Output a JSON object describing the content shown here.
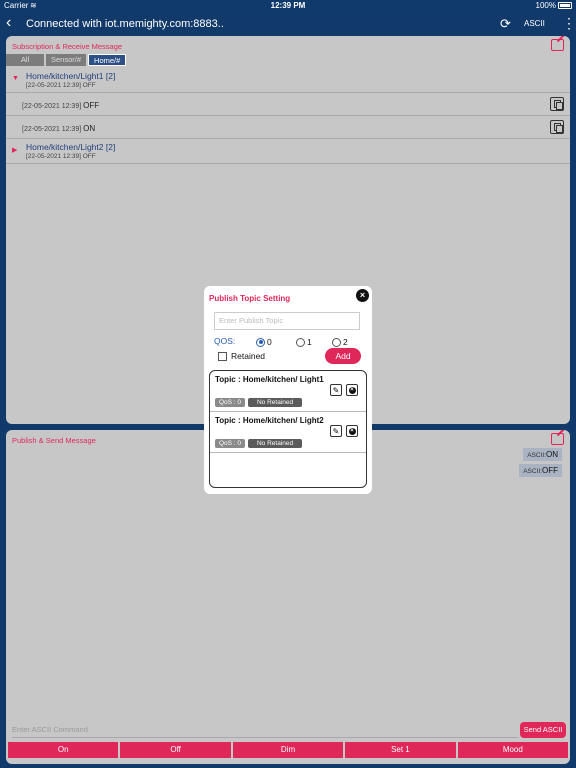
{
  "status_bar": {
    "carrier": "Carrier",
    "time": "12:39 PM",
    "battery": "100%"
  },
  "nav": {
    "title": "Connected with iot.memighty.com:8883..",
    "ascii_label": "ASCII"
  },
  "subscription": {
    "title": "Subscription & Receive Message",
    "filters": [
      "All",
      "Sensor/#",
      "Home/#"
    ],
    "groups": [
      {
        "topic": "Home/kitchen/Light1 [2]",
        "latest": "[22-05-2021 12:39] OFF"
      },
      {
        "topic": "Home/kitchen/Light2 [2]",
        "latest": "[22-05-2021 12:39] OFF"
      }
    ],
    "messages": [
      {
        "ts": "[22-05-2021 12:39]",
        "value": "OFF"
      },
      {
        "ts": "[22-05-2021 12:39]",
        "value": "ON"
      }
    ]
  },
  "publish": {
    "title": "Publish & Send Message",
    "sent": [
      {
        "prefix": "ASCII:",
        "value": "ON"
      },
      {
        "prefix": "ASCII:",
        "value": "OFF"
      }
    ],
    "command_placeholder": "Enter ASCII Command",
    "send_label": "Send ASCII",
    "actions": [
      "On",
      "Off",
      "Dim",
      "Set 1",
      "Mood"
    ]
  },
  "modal": {
    "title": "Publish Topic Setting",
    "close_label": "×",
    "input_placeholder": "Enter Publish Topic",
    "qos_label": "QOS:",
    "qos_options": [
      "0",
      "1",
      "2"
    ],
    "qos_selected": "0",
    "retained_label": "Retained",
    "add_label": "Add",
    "edit_glyph": "✎",
    "topics": [
      {
        "topic": "Topic : Home/kitchen/ Light1",
        "qos": "QoS : 0",
        "retained": "No Retained"
      },
      {
        "topic": "Topic : Home/kitchen/ Light2",
        "qos": "QoS : 0",
        "retained": "No Retained"
      }
    ]
  },
  "colors": {
    "accent": "#e0275a",
    "nav": "#113a6b",
    "panel": "#c7c7c7",
    "link": "#1f3f7a"
  },
  "icons": {
    "back": "chevron-left-icon",
    "refresh": "refresh-icon",
    "more": "more-vertical-icon",
    "edit": "edit-icon",
    "copy": "copy-icon",
    "close": "close-icon",
    "delete": "delete-icon"
  }
}
